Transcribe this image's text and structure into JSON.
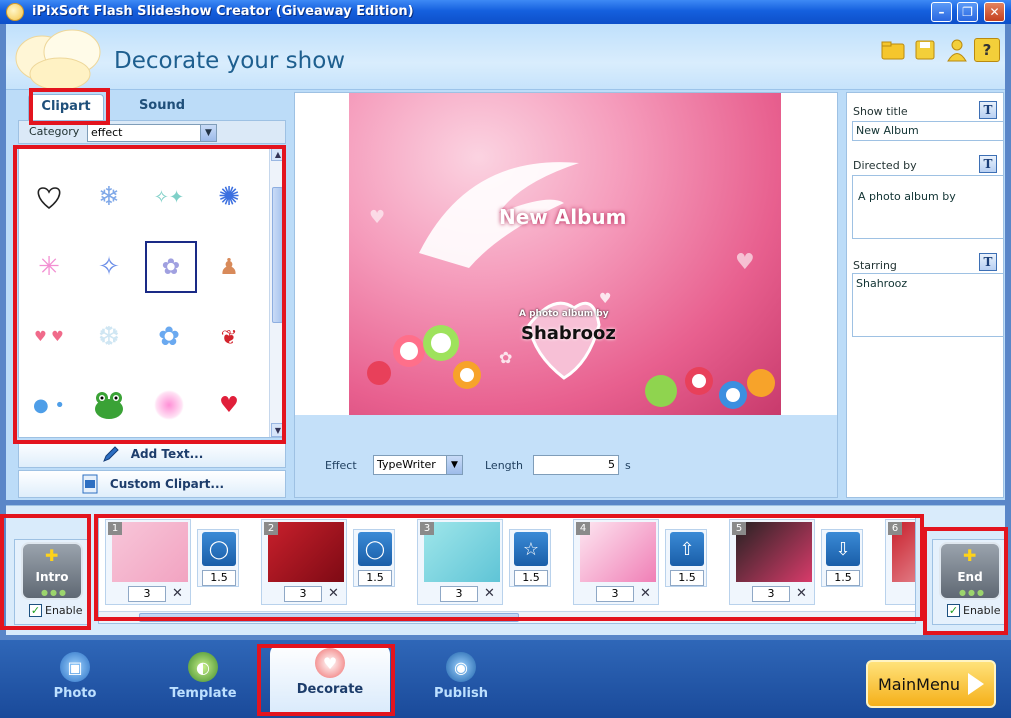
{
  "window": {
    "title": "iPixSoft Flash Slideshow Creator (Giveaway Edition)"
  },
  "header": {
    "heading": "Decorate your show",
    "icons": [
      "folder-icon",
      "save-icon",
      "user-icon",
      "help-icon"
    ],
    "help_glyph": "?"
  },
  "left": {
    "tabs": [
      {
        "label": "Clipart",
        "active": true
      },
      {
        "label": "Sound",
        "active": false
      }
    ],
    "category_label": "Category",
    "category_value": "effect",
    "cliparts": [
      "heart-outline",
      "snowflake",
      "sparkles",
      "blue-star-burst",
      "pink-spark",
      "blue-sparkle",
      "fairy",
      "angel-boy",
      "small-hearts",
      "frost",
      "butterfly",
      "cherries",
      "bubbles",
      "frog",
      "pink-glow",
      "winged-heart"
    ],
    "add_text": "Add Text...",
    "custom_clipart": "Custom Clipart..."
  },
  "preview": {
    "title": "New Album",
    "subtitle": "A photo album by",
    "starring": "Shabrooz"
  },
  "effect": {
    "label": "Effect",
    "value": "TypeWriter",
    "length_label": "Length",
    "length_value": "5",
    "unit": "s"
  },
  "right": {
    "show_title_label": "Show title",
    "show_title_value": "New Album",
    "directed_label": "Directed by",
    "directed_value": "A photo album by",
    "starring_label": "Starring",
    "starring_value": "Shahrooz",
    "text_icon_glyph": "T"
  },
  "timeline": {
    "intro": {
      "label": "Intro",
      "enable": "Enable",
      "checked": true
    },
    "end": {
      "label": "End",
      "enable": "Enable",
      "checked": true
    },
    "slides": [
      {
        "num": "1",
        "duration": "3",
        "colors": [
          "#f7c6d9",
          "#f2a3c1"
        ]
      },
      {
        "num": "2",
        "duration": "3",
        "colors": [
          "#c8202c",
          "#7e0a14"
        ]
      },
      {
        "num": "3",
        "duration": "3",
        "colors": [
          "#9fe6ea",
          "#5fc4d6"
        ]
      },
      {
        "num": "4",
        "duration": "3",
        "colors": [
          "#fde6f1",
          "#f07fb6"
        ]
      },
      {
        "num": "5",
        "duration": "3",
        "colors": [
          "#262222",
          "#d83b6a"
        ]
      },
      {
        "num": "6",
        "duration": "",
        "colors": [
          "#c8202c",
          "#f0b0b8"
        ]
      }
    ],
    "transitions": [
      {
        "duration": "1.5",
        "glyph": "◯"
      },
      {
        "duration": "1.5",
        "glyph": "◯"
      },
      {
        "duration": "1.5",
        "glyph": "☆"
      },
      {
        "duration": "1.5",
        "glyph": "⇧"
      },
      {
        "duration": "1.5",
        "glyph": "⇩"
      }
    ],
    "delete_glyph": "✕",
    "check_glyph": "✓"
  },
  "nav": {
    "items": [
      {
        "label": "Photo",
        "active": false
      },
      {
        "label": "Template",
        "active": false
      },
      {
        "label": "Decorate",
        "active": true
      },
      {
        "label": "Publish",
        "active": false
      }
    ],
    "main_menu": "MainMenu"
  }
}
